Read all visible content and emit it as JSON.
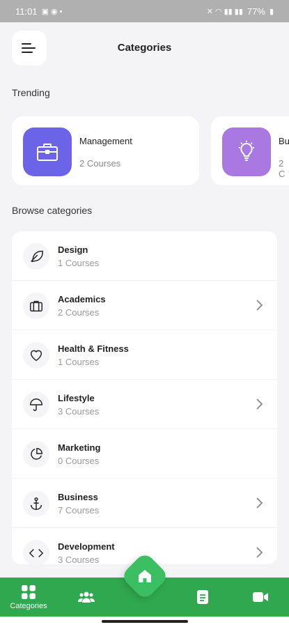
{
  "status_bar": {
    "time": "11:01",
    "battery": "77%"
  },
  "header": {
    "title": "Categories"
  },
  "trending": {
    "label": "Trending",
    "cards": [
      {
        "title": "Management",
        "subtitle": "2 Courses",
        "icon": "briefcase-icon",
        "color": "#6b63e8"
      },
      {
        "title": "Bu",
        "subtitle": "2 C",
        "icon": "lightbulb-icon",
        "color": "#a978e0"
      }
    ]
  },
  "browse": {
    "label": "Browse categories",
    "items": [
      {
        "name": "Design",
        "count": "1 Courses",
        "icon": "feather-icon",
        "chevron": false
      },
      {
        "name": "Academics",
        "count": "2 Courses",
        "icon": "briefcase-icon",
        "chevron": true
      },
      {
        "name": "Health & Fitness",
        "count": "1 Courses",
        "icon": "heart-icon",
        "chevron": false
      },
      {
        "name": "Lifestyle",
        "count": "3 Courses",
        "icon": "umbrella-icon",
        "chevron": true
      },
      {
        "name": "Marketing",
        "count": "0 Courses",
        "icon": "pie-chart-icon",
        "chevron": false
      },
      {
        "name": "Business",
        "count": "7 Courses",
        "icon": "anchor-icon",
        "chevron": true
      },
      {
        "name": "Development",
        "count": "3 Courses",
        "icon": "code-icon",
        "chevron": true
      }
    ]
  },
  "bottom_nav": {
    "items": [
      {
        "label": "Categories",
        "icon": "grid-icon"
      },
      {
        "label": "",
        "icon": "users-icon"
      },
      {
        "label": "",
        "icon": "home-icon"
      },
      {
        "label": "",
        "icon": "document-icon"
      },
      {
        "label": "",
        "icon": "video-icon"
      }
    ],
    "color": "#2fa84f"
  }
}
